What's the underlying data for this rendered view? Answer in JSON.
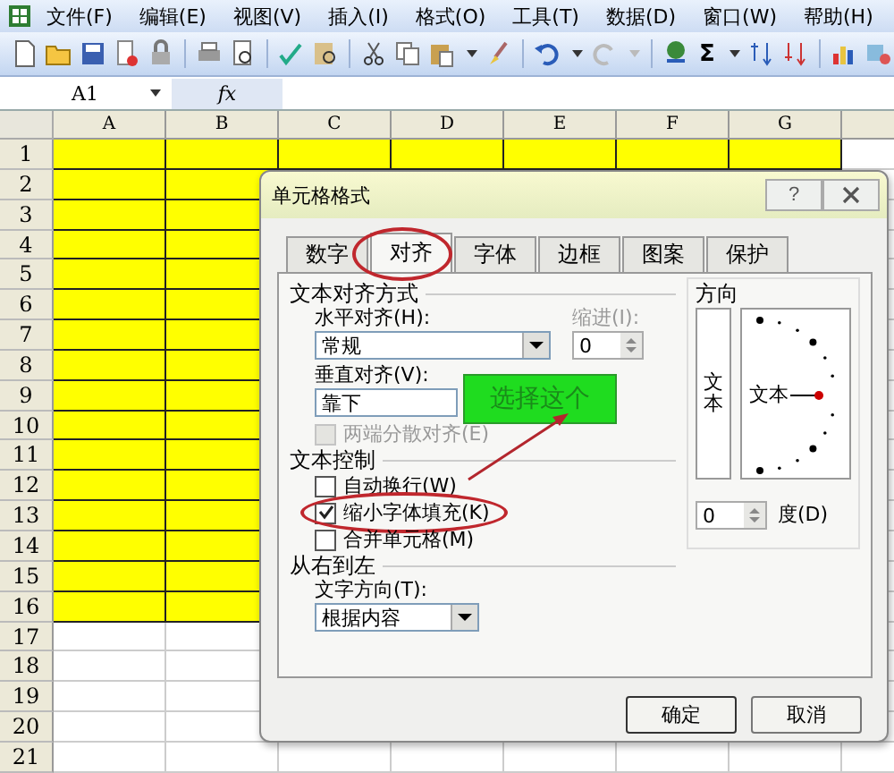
{
  "menu_bar": {
    "items": [
      "文件(F)",
      "编辑(E)",
      "视图(V)",
      "插入(I)",
      "格式(O)",
      "工具(T)",
      "数据(D)",
      "窗口(W)",
      "帮助(H)"
    ]
  },
  "toolbar": {
    "autosum": "Σ"
  },
  "formula_bar": {
    "name_box": "A1",
    "fx": "fx"
  },
  "sheet": {
    "columns": [
      "A",
      "B",
      "C",
      "D",
      "E",
      "F",
      "G"
    ],
    "rows": [
      {
        "label": "1",
        "highlighted": true
      },
      {
        "label": "2",
        "highlighted": true
      },
      {
        "label": "3",
        "highlighted": true
      },
      {
        "label": "4",
        "highlighted": true
      },
      {
        "label": "5",
        "highlighted": true
      },
      {
        "label": "6",
        "highlighted": true
      },
      {
        "label": "7",
        "highlighted": true
      },
      {
        "label": "8",
        "highlighted": true
      },
      {
        "label": "9",
        "highlighted": true
      },
      {
        "label": "10",
        "highlighted": true
      },
      {
        "label": "11",
        "highlighted": true
      },
      {
        "label": "12",
        "highlighted": true
      },
      {
        "label": "13",
        "highlighted": true
      },
      {
        "label": "14",
        "highlighted": true
      },
      {
        "label": "15",
        "highlighted": true
      },
      {
        "label": "16",
        "highlighted": true
      },
      {
        "label": "17",
        "highlighted": false
      },
      {
        "label": "18",
        "highlighted": false
      },
      {
        "label": "19",
        "highlighted": false
      },
      {
        "label": "20",
        "highlighted": false
      },
      {
        "label": "21",
        "highlighted": false
      }
    ]
  },
  "dialog": {
    "title": "单元格格式",
    "help": "?",
    "tabs": [
      {
        "label": "数字",
        "selected": false
      },
      {
        "label": "对齐",
        "selected": true
      },
      {
        "label": "字体",
        "selected": false
      },
      {
        "label": "边框",
        "selected": false
      },
      {
        "label": "图案",
        "selected": false
      },
      {
        "label": "保护",
        "selected": false
      }
    ],
    "alignment": {
      "heading": "文本对齐方式",
      "horizontal_label": "水平对齐(H):",
      "horizontal_value": "常规",
      "indent_label": "缩进(I):",
      "indent_value": "0",
      "vertical_label": "垂直对齐(V):",
      "vertical_value": "靠下"
    },
    "text_control": {
      "distributed": {
        "label": "两端分散对齐(E)",
        "checked": false,
        "disabled": true
      },
      "heading": "文本控制",
      "options": [
        {
          "label": "自动换行(W)",
          "checked": false
        },
        {
          "label": "缩小字体填充(K)",
          "checked": true
        },
        {
          "label": "合并单元格(M)",
          "checked": false
        }
      ]
    },
    "rtl": {
      "heading": "从右到左",
      "direction_label": "文字方向(T):",
      "direction_value": "根据内容"
    },
    "orientation": {
      "heading": "方向",
      "vertical_text": "文本",
      "dial_text": "文本",
      "degrees_value": "0",
      "degrees_label": "度(D)"
    },
    "buttons": [
      "确定",
      "取消"
    ]
  },
  "annotation": {
    "callout": "选择这个"
  }
}
